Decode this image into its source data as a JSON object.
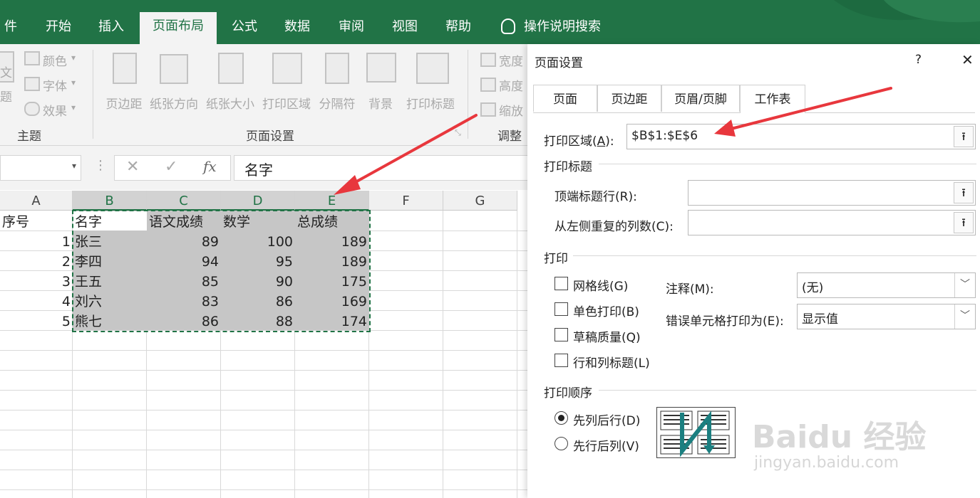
{
  "ribbon_tabs": [
    "件",
    "开始",
    "插入",
    "页面布局",
    "公式",
    "数据",
    "审阅",
    "视图",
    "帮助",
    "操作说明搜索"
  ],
  "ribbon": {
    "theme_small": [
      "颜色",
      "字体",
      "效果"
    ],
    "theme_partial": [
      "文",
      "题"
    ],
    "group_theme": "主题",
    "page_setup_buttons": [
      "页边距",
      "纸张方向",
      "纸张大小",
      "打印区域",
      "分隔符",
      "背景",
      "打印标题"
    ],
    "group_page_setup": "页面设置",
    "scale_small": [
      "宽度",
      "高度",
      "缩放"
    ],
    "group_scale": "调整"
  },
  "formula_bar": {
    "fx": "fx",
    "content": "名字"
  },
  "columns": [
    "A",
    "B",
    "C",
    "D",
    "E",
    "F",
    "G"
  ],
  "sheet": {
    "header": [
      "序号",
      "名字",
      "语文成绩",
      "数学",
      "总成绩"
    ],
    "rows": [
      [
        "1",
        "张三",
        "89",
        "100",
        "189"
      ],
      [
        "2",
        "李四",
        "94",
        "95",
        "189"
      ],
      [
        "3",
        "王五",
        "85",
        "90",
        "175"
      ],
      [
        "4",
        "刘六",
        "83",
        "86",
        "169"
      ],
      [
        "5",
        "熊七",
        "86",
        "88",
        "174"
      ]
    ]
  },
  "dialog": {
    "title": "页面设置",
    "help": "?",
    "close": "✕",
    "tabs": [
      "页面",
      "页边距",
      "页眉/页脚",
      "工作表"
    ],
    "print_area_label": "打印区域(",
    "print_area_key": "A",
    "print_area_suffix": "):",
    "print_area_value": "$B$1:$E$6",
    "print_titles_section": "打印标题",
    "top_rows_label": "顶端标题行(R):",
    "left_cols_label": "从左侧重复的列数(C):",
    "print_section": "打印",
    "checkboxes": [
      "网格线(G)",
      "单色打印(B)",
      "草稿质量(Q)",
      "行和列标题(L)"
    ],
    "comments_label": "注释(M):",
    "comments_value": "(无)",
    "errors_label": "错误单元格打印为(E):",
    "errors_value": "显示值",
    "order_section": "打印顺序",
    "order_options": [
      "先列后行(D)",
      "先行后列(V)"
    ],
    "picker_icon": "⭱"
  },
  "watermark": {
    "brand": "Baidu 经验",
    "url": "jingyan.baidu.com"
  },
  "colors": {
    "excel_green": "#217346",
    "annotation_red": "#e8373d"
  }
}
